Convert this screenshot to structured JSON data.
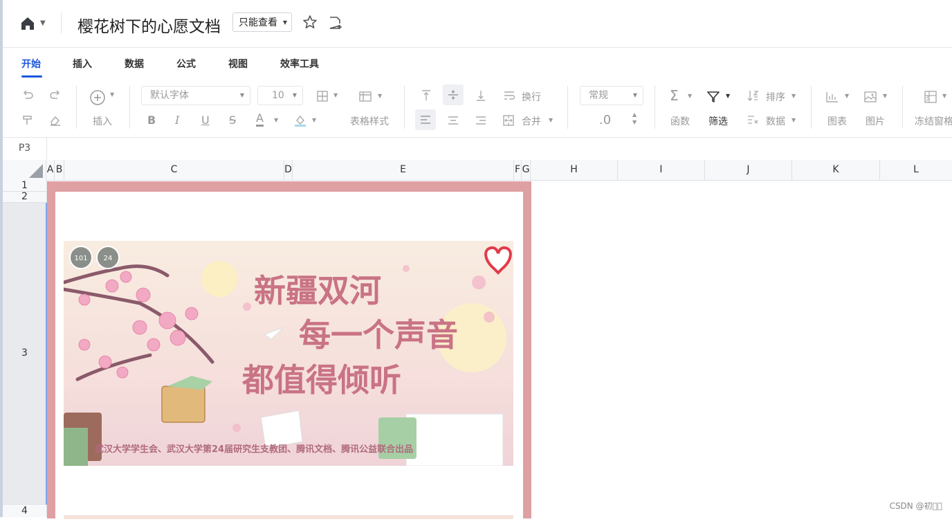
{
  "header": {
    "doc_title": "樱花树下的心愿文档",
    "permission": "只能查看"
  },
  "tabs": [
    {
      "label": "开始",
      "active": true
    },
    {
      "label": "插入"
    },
    {
      "label": "数据"
    },
    {
      "label": "公式"
    },
    {
      "label": "视图"
    },
    {
      "label": "效率工具"
    }
  ],
  "toolbar": {
    "insert": "插入",
    "font": "默认字体",
    "font_size": "10",
    "table_style": "表格样式",
    "wrap": "换行",
    "merge": "合并",
    "format": "常规",
    "decimal": ".0",
    "function": "函数",
    "filter": "筛选",
    "sort": "排序",
    "data": "数据",
    "chart": "图表",
    "image": "图片",
    "freeze": "冻结窗格"
  },
  "cell_ref": "P3",
  "columns": [
    "A",
    "B",
    "C",
    "D",
    "E",
    "F",
    "G",
    "H",
    "I",
    "J",
    "K",
    "L"
  ],
  "rows": [
    "1",
    "2",
    "3",
    "4"
  ],
  "banner": {
    "title1": "新疆双河",
    "title2": "每一个声音",
    "title3": "都值得倾听",
    "footer": "武汉大学学生会、武汉大学第24届研究生支教团、腾讯文档、腾讯公益联合出品",
    "logo1": "101",
    "logo2": "24"
  },
  "watermark": "CSDN @初眸⃰",
  "colors": {
    "accent": "#1a56db",
    "frame": "#dfa0a4",
    "banner_text": "#c97385"
  }
}
